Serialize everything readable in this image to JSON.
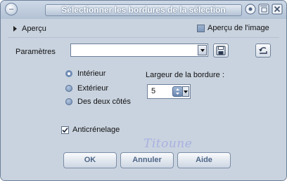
{
  "window": {
    "title": "Sélectionner les bordures de la sélection"
  },
  "preview": {
    "label": "Aperçu",
    "image_preview_label": "Aperçu de l'image",
    "image_preview_checked": true
  },
  "presets": {
    "label": "Paramètres",
    "value": ""
  },
  "side": {
    "options": [
      "Intérieur",
      "Extérieur",
      "Des deux côtés"
    ],
    "selected": "Intérieur"
  },
  "border_width": {
    "label": "Largeur de la bordure :",
    "value": "5"
  },
  "antialias": {
    "label": "Anticrénelage",
    "checked": true
  },
  "watermark": "Titoune",
  "buttons": {
    "ok": "OK",
    "cancel": "Annuler",
    "help": "Aide"
  },
  "icons": {
    "close": "close-icon",
    "help": "help-circle-icon",
    "window": "window-icon",
    "save_preset": "floppy-disk-icon",
    "reset": "reset-arrow-icon"
  },
  "colors": {
    "dialog_bg": "#c9d3df",
    "button_text": "#4d6687",
    "accent_radio": "#6f8cb4"
  }
}
